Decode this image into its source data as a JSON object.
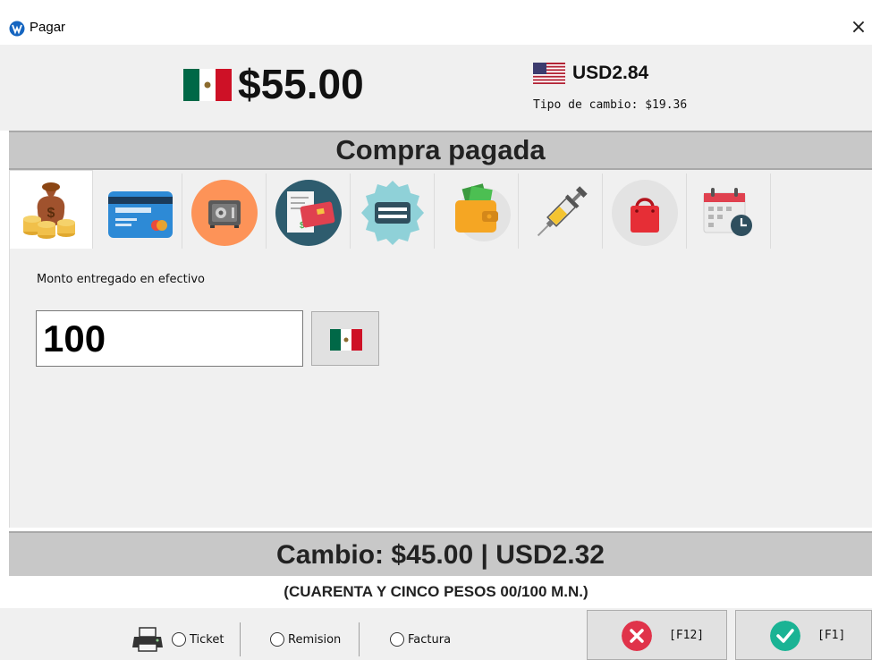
{
  "window": {
    "title": "Pagar",
    "close_glyph": "×",
    "app_icon": "app-logo-icon"
  },
  "totals": {
    "amount_mxn": "$55.00",
    "amount_usd": "USD2.84",
    "exchange_rate_text": "Tipo de cambio: $19.36"
  },
  "status": {
    "label": "Compra pagada"
  },
  "tabs": [
    {
      "icon": "money-bag-coins-icon",
      "active": true
    },
    {
      "icon": "credit-card-icon",
      "active": false
    },
    {
      "icon": "safe-vault-icon",
      "active": false
    },
    {
      "icon": "receipt-card-icon",
      "active": false
    },
    {
      "icon": "check-badge-icon",
      "active": false
    },
    {
      "icon": "wallet-icon",
      "active": false
    },
    {
      "icon": "syringe-icon",
      "active": false
    },
    {
      "icon": "shopping-bag-icon",
      "active": false
    },
    {
      "icon": "calendar-clock-icon",
      "active": false
    }
  ],
  "cash": {
    "label": "Monto entregado en efectivo",
    "value": "100",
    "currency_button_icon": "mexico-flag-icon"
  },
  "change": {
    "summary": "Cambio: $45.00 | USD2.32",
    "in_words": "(CUARENTA Y CINCO PESOS  00/100 M.N.)"
  },
  "document_type": {
    "options": [
      "Ticket",
      "Remision",
      "Factura"
    ],
    "selected": null
  },
  "buttons": {
    "cancel_key": "[F12]",
    "confirm_key": "[F1]"
  },
  "colors": {
    "mx_green": "#006847",
    "mx_red": "#ce1126",
    "cancel_red": "#e0334a",
    "confirm_teal": "#1ab394",
    "banner_gray": "#c8c8c8"
  }
}
